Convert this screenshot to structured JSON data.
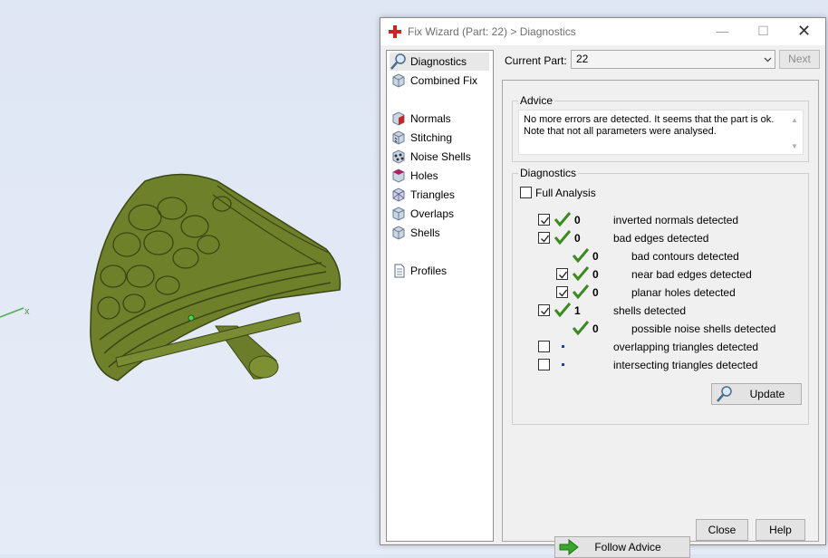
{
  "window": {
    "title": "Fix Wizard (Part: 22) > Diagnostics",
    "minimize_glyph": "—",
    "maximize_glyph": "☐",
    "close_glyph": "✕"
  },
  "viewport": {
    "axis_label": "x",
    "model_color": "#6b7d2a"
  },
  "nav": {
    "top_items": [
      {
        "label": "Diagnostics",
        "icon": "magnifier-icon",
        "active": true
      },
      {
        "label": "Combined Fix",
        "icon": "cube-icon"
      }
    ],
    "fix_items": [
      {
        "label": "Normals",
        "icon": "normals-cube-icon"
      },
      {
        "label": "Stitching",
        "icon": "stitching-cube-icon"
      },
      {
        "label": "Noise Shells",
        "icon": "noise-shells-icon"
      },
      {
        "label": "Holes",
        "icon": "holes-cube-icon"
      },
      {
        "label": "Triangles",
        "icon": "triangles-cube-icon"
      },
      {
        "label": "Overlaps",
        "icon": "overlaps-cube-icon"
      },
      {
        "label": "Shells",
        "icon": "shells-cube-icon"
      }
    ],
    "bottom_items": [
      {
        "label": "Profiles",
        "icon": "document-icon"
      }
    ]
  },
  "current_part": {
    "label": "Current Part:",
    "value": "22",
    "next_label": "Next"
  },
  "advice": {
    "title": "Advice",
    "line1": "No more errors are detected. It seems that the part is ok.",
    "line2": "Note that not all parameters were analysed."
  },
  "diagnostics": {
    "title": "Diagnostics",
    "full_analysis_label": "Full Analysis",
    "full_analysis_checked": false,
    "rows": [
      {
        "count": "0",
        "label": "inverted normals detected",
        "checked": true,
        "ok": true,
        "indent": 0
      },
      {
        "count": "0",
        "label": "bad edges detected",
        "checked": true,
        "ok": true,
        "indent": 0
      },
      {
        "count": "0",
        "label": "bad contours detected",
        "checkbox": false,
        "ok": true,
        "indent": 1
      },
      {
        "count": "0",
        "label": "near bad edges detected",
        "checked": true,
        "ok": true,
        "indent": 1
      },
      {
        "count": "0",
        "label": "planar holes detected",
        "checked": true,
        "ok": true,
        "indent": 1
      },
      {
        "count": "1",
        "label": "shells detected",
        "checked": true,
        "ok": true,
        "indent": 0
      },
      {
        "count": "0",
        "label": "possible noise shells detected",
        "checkbox": false,
        "ok": true,
        "indent": 1
      },
      {
        "count": "",
        "label": "overlapping triangles detected",
        "checked": false,
        "ok": false,
        "indent": 0
      },
      {
        "count": "",
        "label": "intersecting triangles detected",
        "checked": false,
        "ok": false,
        "indent": 0
      }
    ],
    "update_label": "Update"
  },
  "footer": {
    "follow_advice_label": "Follow Advice",
    "close_label": "Close",
    "help_label": "Help"
  },
  "colors": {
    "tick_green": "#3a8a1e",
    "arrow_green": "#3aa62a",
    "title_red": "#d42020"
  }
}
